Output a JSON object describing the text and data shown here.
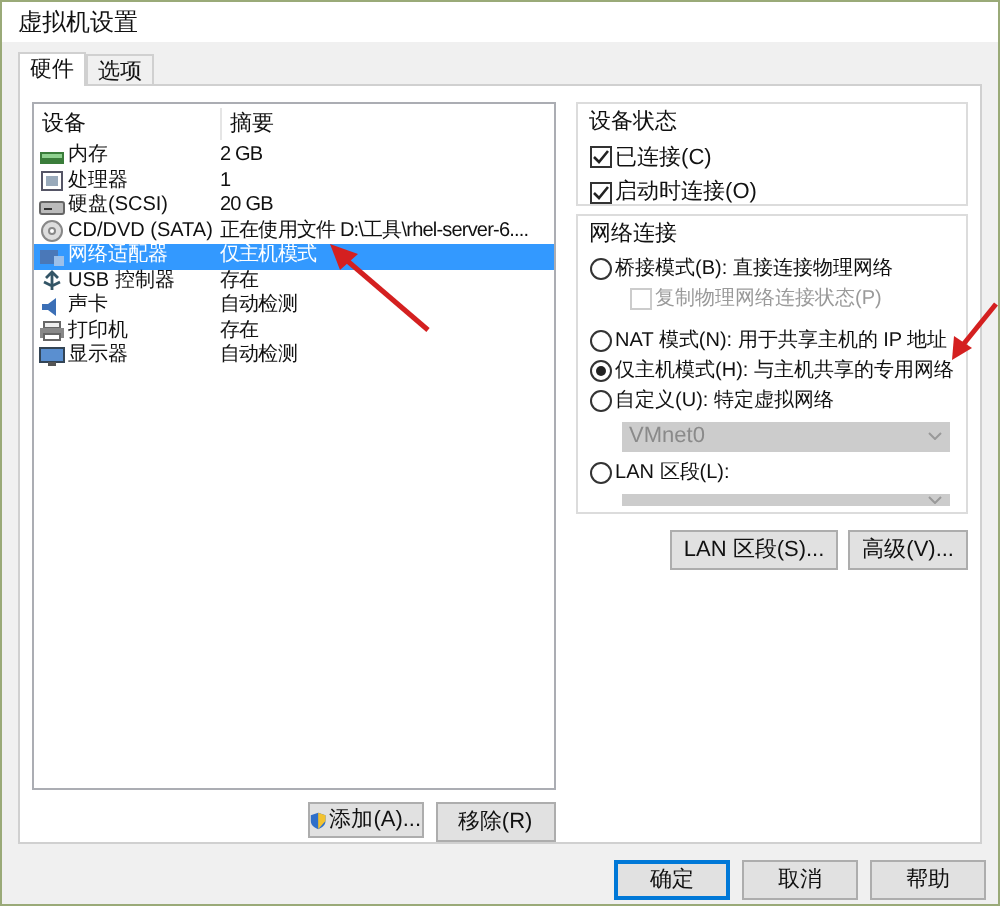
{
  "window": {
    "title": "虚拟机设置"
  },
  "tabs": [
    {
      "label": "硬件",
      "selected": true
    },
    {
      "label": "选项",
      "selected": false
    }
  ],
  "device_list": {
    "columns": [
      "设备",
      "摘要"
    ],
    "rows": [
      {
        "device": "内存",
        "summary": "2 GB",
        "selected": false
      },
      {
        "device": "处理器",
        "summary": "1",
        "selected": false
      },
      {
        "device": "硬盘(SCSI)",
        "summary": "20 GB",
        "selected": false
      },
      {
        "device": "CD/DVD (SATA)",
        "summary": "正在使用文件 D:\\工具\\rhel-server-6....",
        "selected": false
      },
      {
        "device": "网络适配器",
        "summary": "仅主机模式",
        "selected": true
      },
      {
        "device": "USB 控制器",
        "summary": "存在",
        "selected": false
      },
      {
        "device": "声卡",
        "summary": "自动检测",
        "selected": false
      },
      {
        "device": "打印机",
        "summary": "存在",
        "selected": false
      },
      {
        "device": "显示器",
        "summary": "自动检测",
        "selected": false
      }
    ]
  },
  "list_buttons": [
    "添加(A)...",
    "移除(R)"
  ],
  "device_status": {
    "title": "设备状态",
    "options": [
      {
        "label": "已连接(C)",
        "checked": true
      },
      {
        "label": "启动时连接(O)",
        "checked": true
      }
    ]
  },
  "network_connection": {
    "title": "网络连接",
    "options": [
      {
        "kind": "radio",
        "label": "桥接模式(B): 直接连接物理网络",
        "selected": false
      },
      {
        "kind": "checkbox",
        "label": "复制物理网络连接状态(P)",
        "checked": false,
        "disabled": true
      },
      {
        "kind": "radio",
        "label": "NAT 模式(N): 用于共享主机的 IP 地址",
        "selected": false
      },
      {
        "kind": "radio",
        "label": "仅主机模式(H): 与主机共享的专用网络",
        "selected": true
      },
      {
        "kind": "radio",
        "label": "自定义(U): 特定虚拟网络",
        "selected": false
      },
      {
        "kind": "dropdown",
        "value": "VMnet0",
        "disabled": true
      },
      {
        "kind": "radio",
        "label": "LAN 区段(L):",
        "selected": false
      },
      {
        "kind": "dropdown",
        "disabled": true
      }
    ]
  },
  "network_buttons": [
    "LAN 区段(S)...",
    "高级(V)..."
  ],
  "dialog_buttons": [
    {
      "label": "确定",
      "default": true
    },
    {
      "label": "取消",
      "default": false
    },
    {
      "label": "帮助",
      "default": false
    }
  ]
}
